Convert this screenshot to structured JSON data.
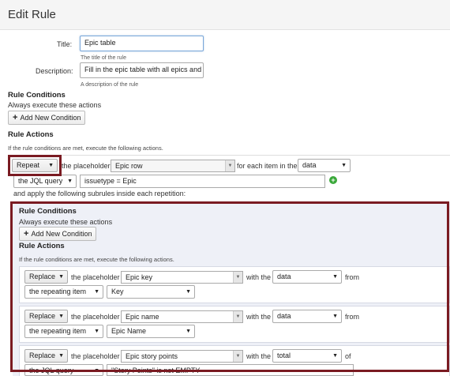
{
  "header": {
    "title": "Edit Rule"
  },
  "form": {
    "title_label": "Title:",
    "title_value": "Epic table",
    "title_help": "The title of the rule",
    "description_label": "Description:",
    "description_value": "Fill in the epic table with all epics and s",
    "description_help": "A description of the rule"
  },
  "conditions": {
    "heading": "Rule Conditions",
    "text": "Always execute these actions",
    "add_button": "Add New Condition"
  },
  "actions": {
    "heading": "Rule Actions",
    "text": "If the rule conditions are met, execute the following actions."
  },
  "repeat": {
    "action_select": "Repeat",
    "t_placeholder": "the placeholder",
    "placeholder_value": "Epic row",
    "t_for_each": "for each item in the",
    "source_select": "data",
    "jql_select": "the JQL query",
    "jql_value": "issuetype = Epic",
    "t_apply": "and apply the following subrules inside each repetition:"
  },
  "inner": {
    "conditions_heading": "Rule Conditions",
    "conditions_text": "Always execute these actions",
    "add_button": "Add New Condition",
    "actions_heading": "Rule Actions",
    "actions_text": "If the rule conditions are met, execute the following actions."
  },
  "subrules": [
    {
      "action": "Replace",
      "t_placeholder": "the placeholder",
      "placeholder": "Epic key",
      "t_with": "with the",
      "source": "data",
      "t_from": "from",
      "item_select": "the repeating item",
      "field_select": "Key"
    },
    {
      "action": "Replace",
      "t_placeholder": "the placeholder",
      "placeholder": "Epic name",
      "t_with": "with the",
      "source": "data",
      "t_from": "from",
      "item_select": "the repeating item",
      "field_select": "Epic Name"
    },
    {
      "action": "Replace",
      "t_placeholder": "the placeholder",
      "placeholder": "Epic story points",
      "t_with": "with the",
      "source": "total",
      "t_from": "of",
      "item_select": "the JQL query",
      "field_value": "\"Story Points\" is not EMPTY"
    }
  ],
  "colors": {
    "highlight": "#7a1b22",
    "focus_border": "#7aa7d9",
    "inner_bg": "#eef0f7",
    "add_green": "#3aa83a"
  },
  "icons": {
    "add_condition": "plus-icon",
    "add_row": "plus-circle-icon",
    "dropdown": "caret-down-icon"
  }
}
